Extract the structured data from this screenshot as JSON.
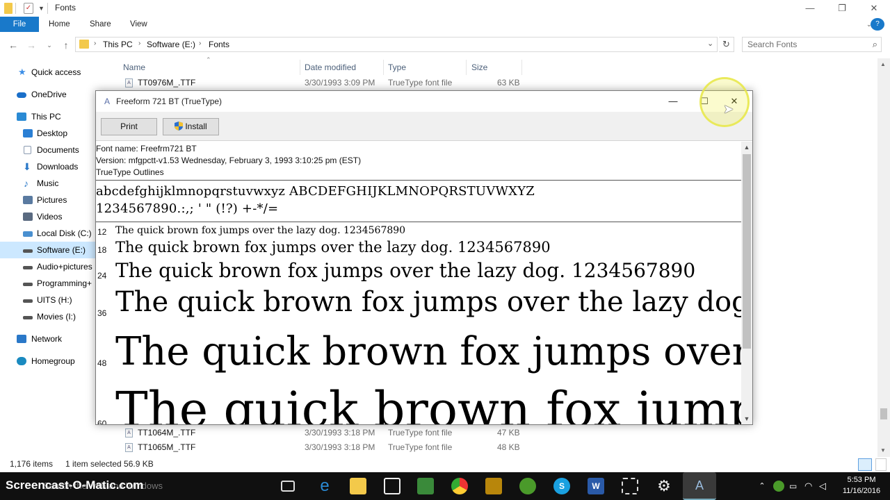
{
  "explorer": {
    "title": "Fonts",
    "tabs": [
      "File",
      "Home",
      "Share",
      "View"
    ],
    "breadcrumb": [
      "This PC",
      "Software (E:)",
      "Fonts"
    ],
    "search_placeholder": "Search Fonts",
    "nav": [
      {
        "label": "Quick access",
        "icon": "star-icon",
        "color": "#3c8ee6"
      },
      {
        "label": "OneDrive",
        "icon": "cloud-icon",
        "color": "#1a6fc9"
      },
      {
        "label": "This PC",
        "icon": "computer-icon",
        "color": "#2a8ad4"
      },
      {
        "label": "Desktop",
        "icon": "desktop-icon",
        "color": "#2a7fd4"
      },
      {
        "label": "Documents",
        "icon": "document-icon",
        "color": "#8a9ab0"
      },
      {
        "label": "Downloads",
        "icon": "download-icon",
        "color": "#2a78c8"
      },
      {
        "label": "Music",
        "icon": "music-icon",
        "color": "#2a78c8"
      },
      {
        "label": "Pictures",
        "icon": "pictures-icon",
        "color": "#5a7aa0"
      },
      {
        "label": "Videos",
        "icon": "videos-icon",
        "color": "#5a6a80"
      },
      {
        "label": "Local Disk (C:)",
        "icon": "drive-icon",
        "color": "#4a90d0"
      },
      {
        "label": "Software (E:)",
        "icon": "drive-icon",
        "color": "#555555"
      },
      {
        "label": "Audio+pictures",
        "icon": "drive-icon",
        "color": "#555555"
      },
      {
        "label": "Programming+",
        "icon": "drive-icon",
        "color": "#555555"
      },
      {
        "label": "UITS (H:)",
        "icon": "drive-icon",
        "color": "#555555"
      },
      {
        "label": "Movies (I:)",
        "icon": "drive-icon",
        "color": "#555555"
      },
      {
        "label": "Network",
        "icon": "network-icon",
        "color": "#2a78c8"
      },
      {
        "label": "Homegroup",
        "icon": "homegroup-icon",
        "color": "#1a8ac0"
      }
    ],
    "columns": {
      "name": "Name",
      "date": "Date modified",
      "type": "Type",
      "size": "Size"
    },
    "files": [
      {
        "name": "TT0976M_.TTF",
        "date": "3/30/1993 3:09 PM",
        "type": "TrueType font file",
        "size": "63 KB"
      },
      {
        "name": "TT1064M_.TTF",
        "date": "3/30/1993 3:18 PM",
        "type": "TrueType font file",
        "size": "47 KB"
      },
      {
        "name": "TT1065M_.TTF",
        "date": "3/30/1993 3:18 PM",
        "type": "TrueType font file",
        "size": "48 KB"
      }
    ],
    "status": {
      "items": "1,176 items",
      "selected": "1 item selected  56.9 KB"
    }
  },
  "dialog": {
    "title": "Freeform 721 BT (TrueType)",
    "print_label": "Print",
    "install_label": "Install",
    "font_name": "Font name: Freefrm721 BT",
    "version": "Version: mfgpctt-v1.53 Wednesday, February 3, 1993 3:10:25 pm (EST)",
    "outline": "TrueType Outlines",
    "charset_line1": "abcdefghijklmnopqrstuvwxyz ABCDEFGHIJKLMNOPQRSTUVWXYZ",
    "charset_line2": "1234567890.:,; ' \" (!?) +-*/=",
    "samples": [
      {
        "size": "12",
        "text": "The quick brown fox jumps over the lazy dog. 1234567890"
      },
      {
        "size": "18",
        "text": "The quick brown fox jumps over the lazy dog. 1234567890"
      },
      {
        "size": "24",
        "text": "The quick brown fox jumps over the lazy dog. 1234567890"
      },
      {
        "size": "36",
        "text": "The quick brown fox jumps over the lazy dog"
      },
      {
        "size": "48",
        "text": "The quick brown fox jumps over"
      },
      {
        "size": "60",
        "text": "The quick brown fox jumps"
      }
    ]
  },
  "taskbar": {
    "watermark": "Screencast-O-Matic.com",
    "search_ghost": "Search the web and Windows",
    "time": "5:53 PM",
    "date": "11/16/2016"
  }
}
